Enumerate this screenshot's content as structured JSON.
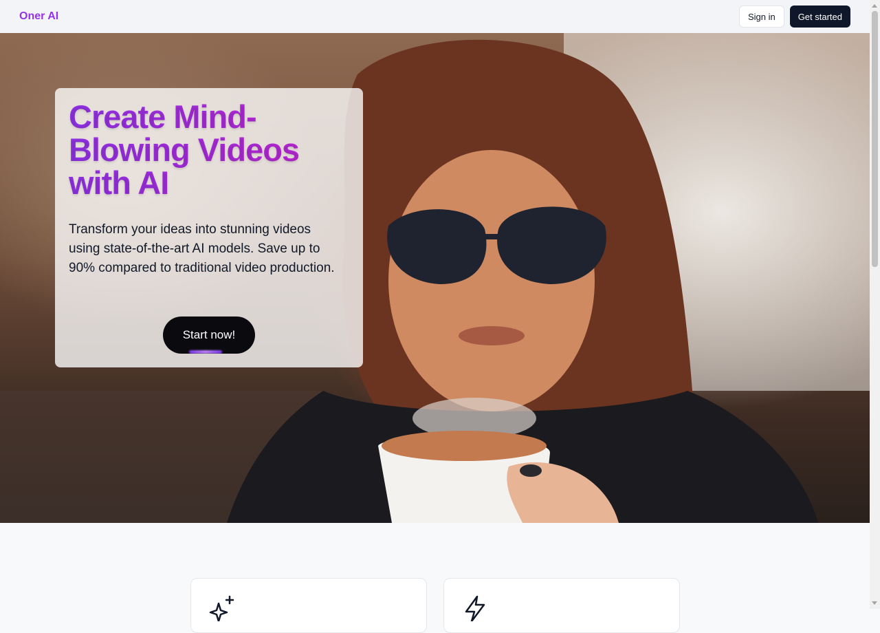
{
  "nav": {
    "logo": "Oner AI",
    "signin_label": "Sign in",
    "getstarted_label": "Get started"
  },
  "hero": {
    "title": "Create Mind-Blowing Videos with AI",
    "subtitle": "Transform your ideas into stunning videos using state-of-the-art AI models. Save up to 90% compared to traditional video production.",
    "cta_label": "Start now!"
  },
  "features": {
    "cards": [
      {
        "icon": "sparkles-icon"
      },
      {
        "icon": "lightning-icon"
      }
    ]
  },
  "colors": {
    "brand": "#9333ea",
    "brand_gradient_end": "#c026d3",
    "primary_button": "#0f172a"
  }
}
